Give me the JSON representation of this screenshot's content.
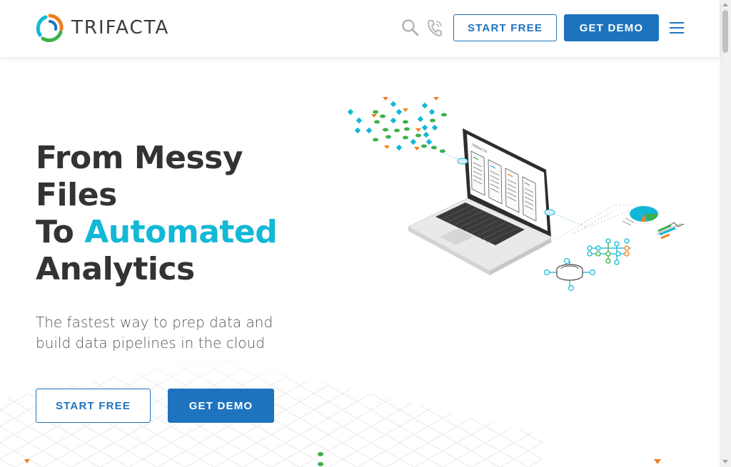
{
  "header": {
    "brand": "TRIFACTA",
    "start_free": "START FREE",
    "get_demo": "GET DEMO"
  },
  "icons": {
    "search": "search-icon",
    "phone": "phone-icon",
    "menu": "hamburger-menu-icon"
  },
  "hero": {
    "title_line1": "From Messy",
    "title_line2": "Files",
    "title_line3_prefix": "To ",
    "title_line3_accent": "Automated",
    "title_line4": "Analytics",
    "subtitle": "The fastest way to prep data and build data pipelines in the cloud",
    "start_free": "START FREE",
    "get_demo": "GET DEMO"
  },
  "illustration": {
    "laptop_brand": "TRIFACTA"
  },
  "colors": {
    "primary": "#1e73be",
    "accent": "#12b8d6",
    "text": "#333333",
    "orange": "#f07f20",
    "green": "#3db04a"
  }
}
